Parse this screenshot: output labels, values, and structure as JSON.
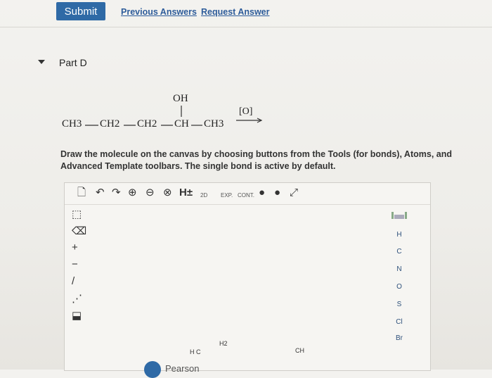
{
  "top_bar": {
    "submit_label": "Submit",
    "previous_answers_label": "Previous Answers",
    "request_answer_label": "Request Answer"
  },
  "part": {
    "title": "Part D"
  },
  "reaction": {
    "substituent": "OH",
    "chain": [
      "CH3",
      "CH2",
      "CH2",
      "CH",
      "CH3"
    ],
    "reagent": "[O]"
  },
  "instructions": "Draw the molecule on the canvas by choosing buttons from the Tools (for bonds), Atoms, and Advanced Template toolbars. The single bond is active by default.",
  "toolbar": {
    "h_label": "H±",
    "twod_label": "2D",
    "exp_label": "EXP.",
    "cont_label": "CONT."
  },
  "atoms": [
    "H",
    "C",
    "N",
    "O",
    "S",
    "Cl",
    "Br"
  ],
  "bottom_molecule": {
    "h2_label": "H2",
    "left_label": "H C",
    "right_label": "CH"
  },
  "footer": {
    "brand": "Pearson"
  }
}
